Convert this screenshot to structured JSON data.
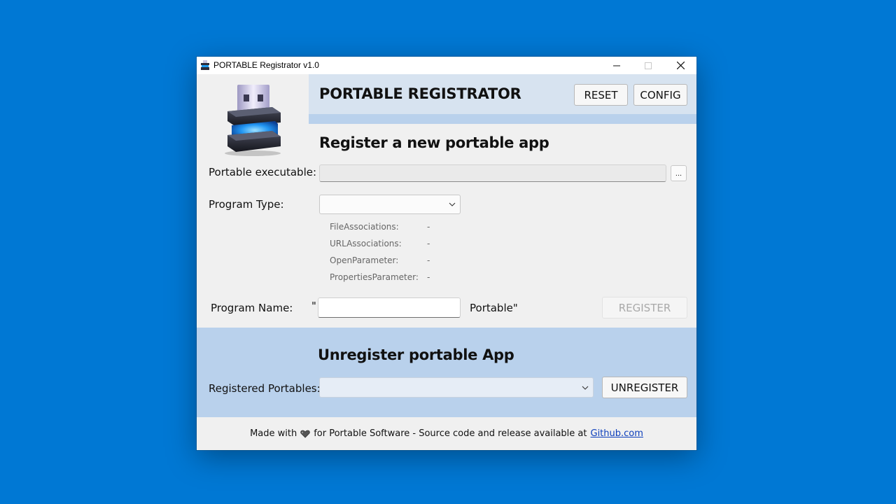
{
  "window": {
    "title": "PORTABLE Registrator v1.0"
  },
  "header": {
    "app_title": "PORTABLE REGISTRATOR",
    "reset_label": "RESET",
    "config_label": "CONFIG"
  },
  "register": {
    "section_title": "Register a new portable app",
    "exe_label": "Portable executable:",
    "exe_value": "",
    "browse_label": "...",
    "type_label": "Program Type:",
    "type_selected": "",
    "info": [
      {
        "key": "FileAssociations:",
        "value": "-"
      },
      {
        "key": "URLAssociations:",
        "value": "-"
      },
      {
        "key": "OpenParameter:",
        "value": "-"
      },
      {
        "key": "PropertiesParameter:",
        "value": "-"
      }
    ],
    "name_label": "Program Name:",
    "name_prefix": "\"",
    "name_value": "",
    "name_suffix": "Portable\"",
    "register_label": "REGISTER"
  },
  "unregister": {
    "section_title": "Unregister portable App",
    "registered_label": "Registered Portables:",
    "registered_selected": "",
    "unregister_label": "UNREGISTER"
  },
  "footer": {
    "text_before": "Made with",
    "text_after": "for Portable Software - Source code and release available at",
    "link_text": "Github.com"
  },
  "colors": {
    "desktop": "#0078d4",
    "header_band": "#d7e3f0",
    "accent_band": "#b9d1ec",
    "window_bg": "#f0f0f0"
  },
  "icons": [
    "app-logo-icon",
    "minimize-icon",
    "maximize-icon",
    "close-icon",
    "chevron-down-icon",
    "heart-icon"
  ]
}
